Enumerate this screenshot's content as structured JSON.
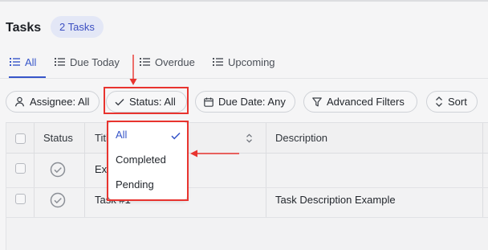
{
  "header": {
    "title": "Tasks",
    "count_badge": "2 Tasks"
  },
  "tabs": [
    {
      "label": "All",
      "icon": "list-icon",
      "active": true
    },
    {
      "label": "Due Today",
      "icon": "list-icon",
      "active": false
    },
    {
      "label": "Overdue",
      "icon": "list-icon",
      "active": false
    },
    {
      "label": "Upcoming",
      "icon": "list-icon",
      "active": false
    }
  ],
  "filters": {
    "assignee": "Assignee: All",
    "status": "Status: All",
    "due_date": "Due Date: Any",
    "advanced": "Advanced Filters",
    "sort": "Sort"
  },
  "table": {
    "columns": [
      "Status",
      "Title",
      "Description"
    ],
    "rows": [
      {
        "title": "Ex",
        "description": ""
      },
      {
        "title": "Task #1",
        "description": "Task Description Example"
      }
    ]
  },
  "status_dropdown": {
    "options": [
      "All",
      "Completed",
      "Pending"
    ],
    "selected": "All"
  },
  "colors": {
    "accent": "#3756c9",
    "annotation": "#e8342f",
    "badge_bg": "#e3e7f6"
  }
}
